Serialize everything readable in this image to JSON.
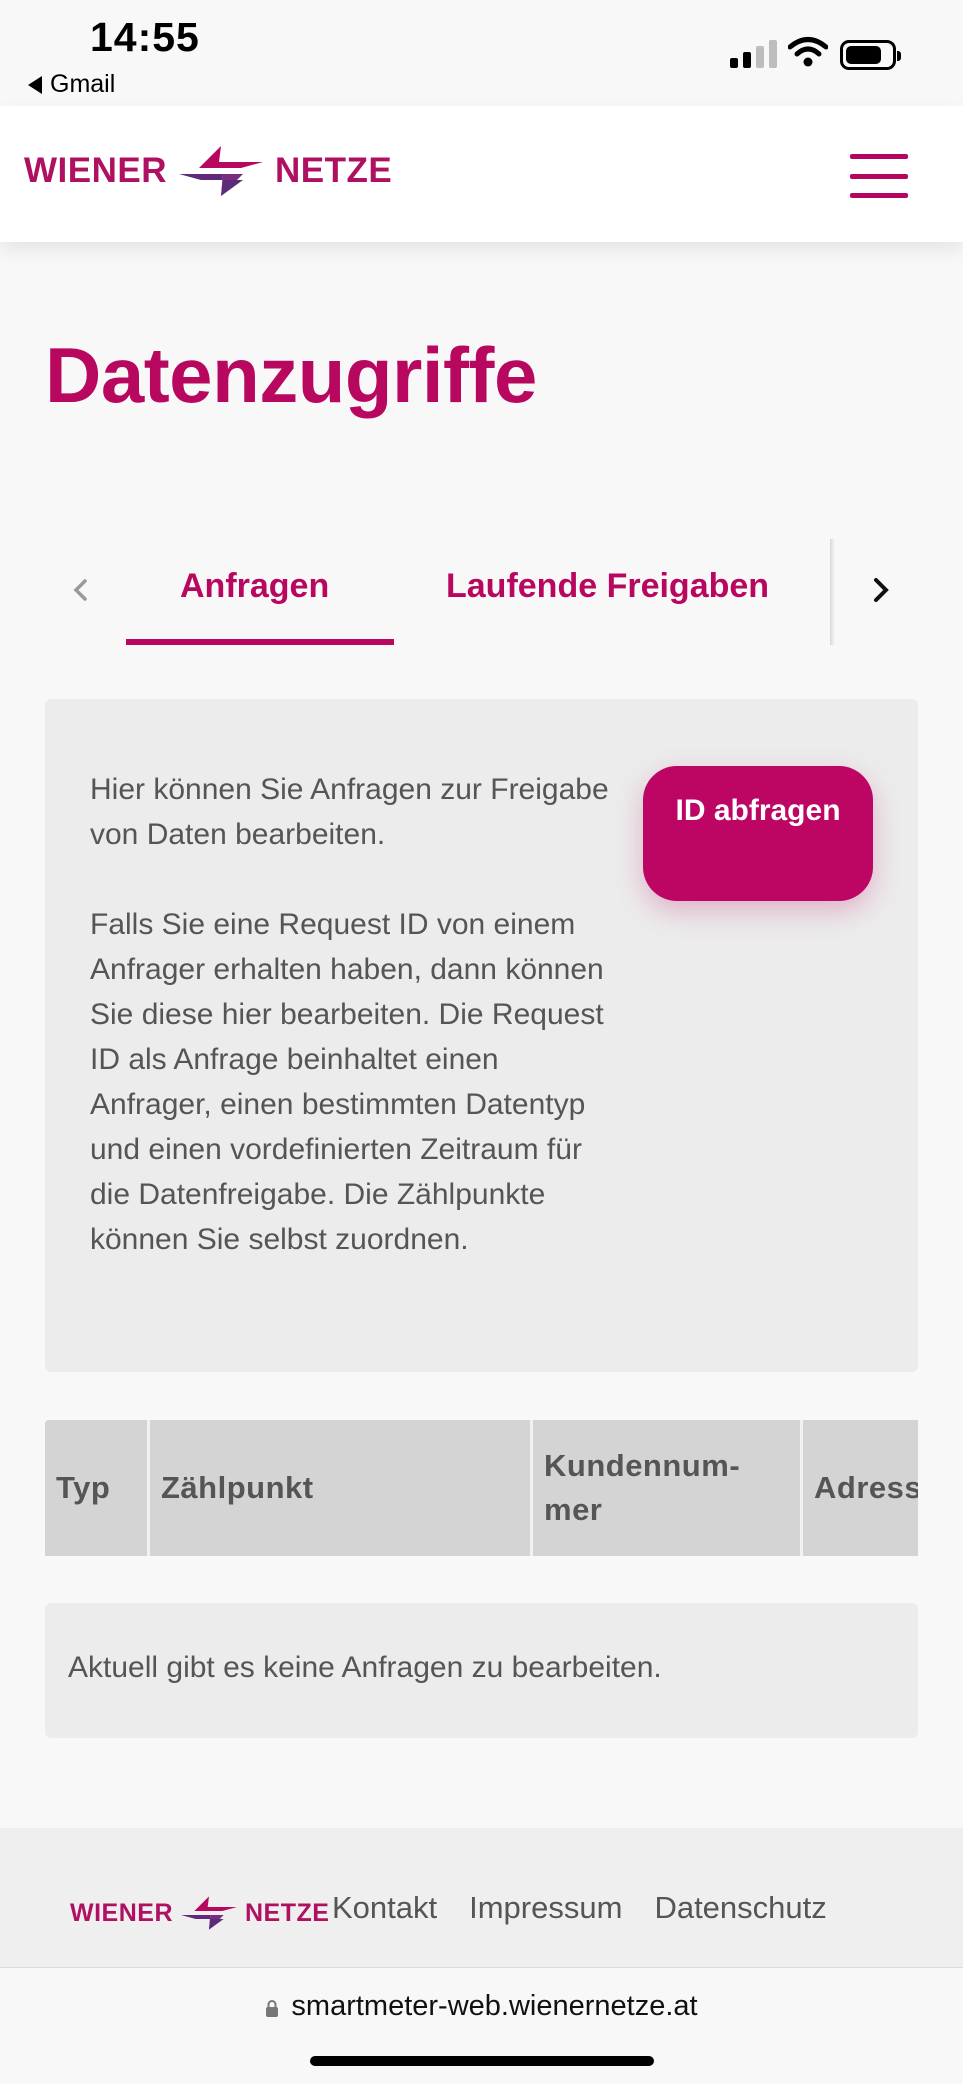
{
  "status_bar": {
    "time": "14:55",
    "back_app": "Gmail"
  },
  "header": {
    "logo_left": "WIENER",
    "logo_right": "NETZE",
    "brand_color": "#b8075f"
  },
  "page": {
    "title": "Datenzugriffe"
  },
  "tabs": [
    {
      "label": "Anfragen",
      "active": true
    },
    {
      "label": "Laufende Freigaben",
      "active": false
    }
  ],
  "info": {
    "paragraph_1": "Hier können Sie Anfragen zur Freigabe von Daten bearbeiten.",
    "paragraph_2": "Falls Sie eine Request ID von einem Anfrager erhalten haben, dann können Sie diese hier bearbeiten. Die Request ID als Anfrage beinhaltet einen Anfrager, einen bestimmten Datentyp und einen vordefinierten Zeitraum für die Datenfreigabe. Die Zählpunkte können Sie selbst zuordnen.",
    "button_label": "ID abfragen"
  },
  "table": {
    "columns": [
      "Typ",
      "Zählpunkt",
      "Kundennum­mer",
      "Adresse"
    ]
  },
  "empty_state": {
    "message": "Aktuell gibt es keine Anfragen zu bearbeiten."
  },
  "footer": {
    "links": [
      "Kontakt",
      "Impressum",
      "Datenschutz"
    ]
  },
  "browser": {
    "url": "smartmeter-web.wienernetze.at"
  }
}
